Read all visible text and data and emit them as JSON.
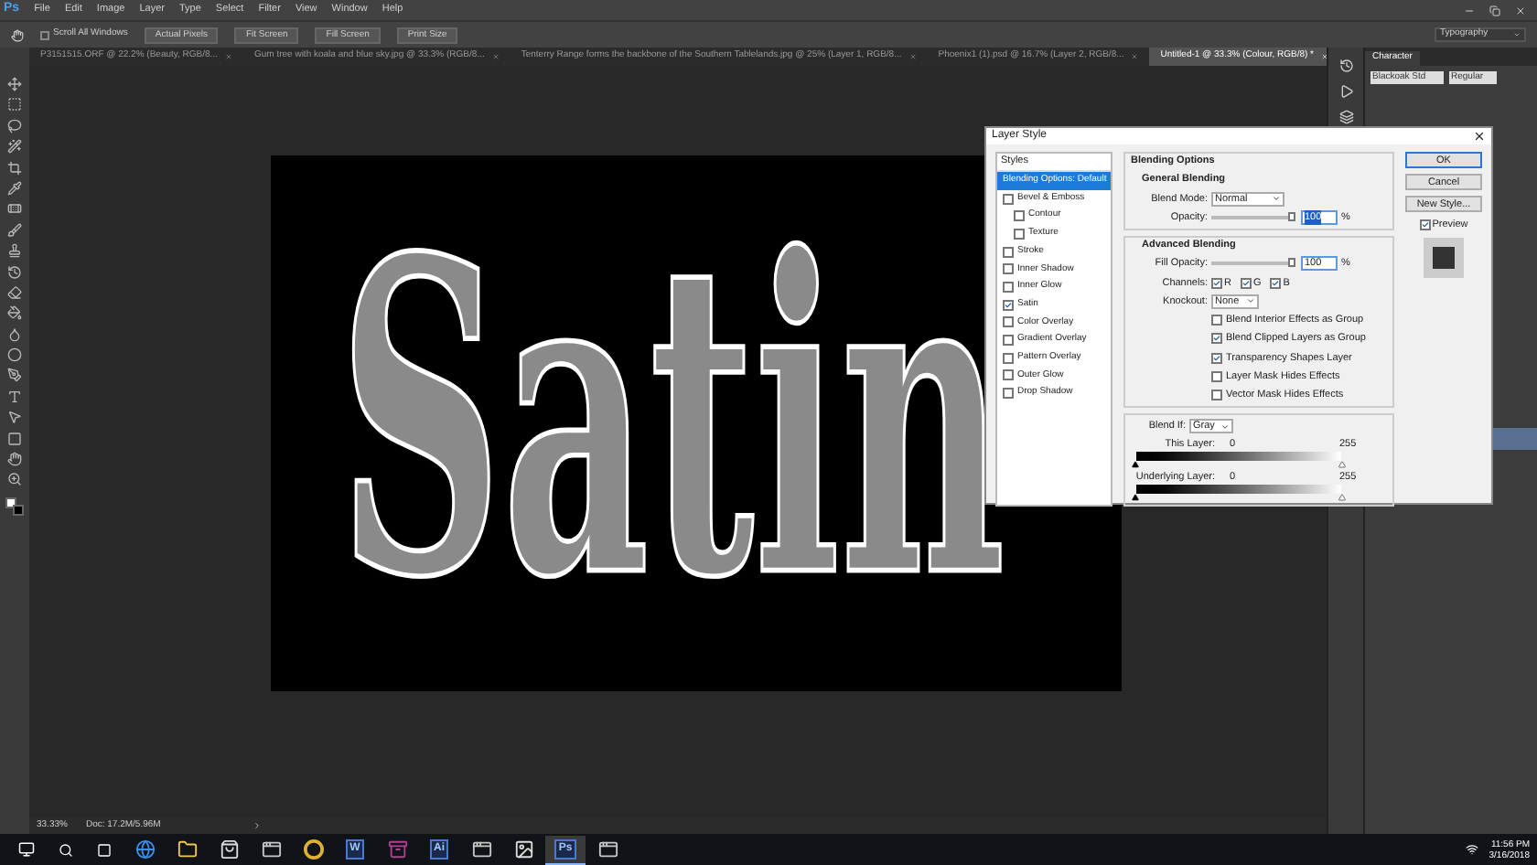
{
  "app": {
    "logo": "Ps"
  },
  "menu": [
    "File",
    "Edit",
    "Image",
    "Layer",
    "Type",
    "Select",
    "Filter",
    "View",
    "Window",
    "Help"
  ],
  "options_bar": {
    "scroll_all_windows": {
      "label": "Scroll All Windows",
      "checked": false
    },
    "buttons": [
      "Actual Pixels",
      "Fit Screen",
      "Fill Screen",
      "Print Size"
    ],
    "workspace": "Typography"
  },
  "tabs": [
    {
      "label": "P3151515.ORF @ 22.2% (Beauty, RGB/8...",
      "selected": false
    },
    {
      "label": "Gum tree with koala and blue sky.jpg @ 33.3% (RGB/8...",
      "selected": false
    },
    {
      "label": "Tenterry Range forms the backbone of the Southern Tablelands.jpg @ 25% (Layer 1, RGB/8...",
      "selected": false
    },
    {
      "label": "Phoenix1 (1).psd @ 16.7% (Layer 2, RGB/8...",
      "selected": false
    },
    {
      "label": "Untitled-1 @ 33.3% (Colour, RGB/8) *",
      "selected": true
    }
  ],
  "canvas": {
    "text": "Satin"
  },
  "character_panel": {
    "title": "Character",
    "font_family": "Blackoak Std",
    "font_style": "Regular"
  },
  "dialog": {
    "title": "Layer Style",
    "styles_header": "Styles",
    "styles": [
      {
        "label": "Blending Options: Default",
        "kind": "plain",
        "selected": true
      },
      {
        "label": "Bevel & Emboss",
        "kind": "check",
        "checked": false,
        "selected": false,
        "children": [
          {
            "label": "Contour",
            "kind": "check",
            "checked": false,
            "selected": false
          },
          {
            "label": "Texture",
            "kind": "check",
            "checked": false,
            "selected": false
          }
        ]
      },
      {
        "label": "Stroke",
        "kind": "check",
        "checked": false,
        "selected": false
      },
      {
        "label": "Inner Shadow",
        "kind": "check",
        "checked": false,
        "selected": false
      },
      {
        "label": "Inner Glow",
        "kind": "check",
        "checked": false,
        "selected": false
      },
      {
        "label": "Satin",
        "kind": "check",
        "checked": true,
        "selected": false
      },
      {
        "label": "Color Overlay",
        "kind": "check",
        "checked": false,
        "selected": false
      },
      {
        "label": "Gradient Overlay",
        "kind": "check",
        "checked": false,
        "selected": false
      },
      {
        "label": "Pattern Overlay",
        "kind": "check",
        "checked": false,
        "selected": false
      },
      {
        "label": "Outer Glow",
        "kind": "check",
        "checked": false,
        "selected": false
      },
      {
        "label": "Drop Shadow",
        "kind": "check",
        "checked": false,
        "selected": false
      }
    ],
    "blending": {
      "title": "Blending Options",
      "general": {
        "title": "General Blending",
        "blend_mode_label": "Blend Mode:",
        "blend_mode": "Normal",
        "opacity": {
          "label": "Opacity:",
          "level": 1,
          "value": "100",
          "unit": "%"
        }
      },
      "advanced": {
        "title": "Advanced Blending",
        "fill_opacity": {
          "label": "Fill Opacity:",
          "level": 1,
          "value": "100",
          "unit": "%"
        },
        "channels_label": "Channels:",
        "channels": [
          {
            "label": "R",
            "checked": true
          },
          {
            "label": "G",
            "checked": true
          },
          {
            "label": "B",
            "checked": true
          }
        ],
        "knockout_label": "Knockout:",
        "knockout": "None",
        "options": [
          {
            "label": "Blend Interior Effects as Group",
            "checked": false
          },
          {
            "label": "Blend Clipped Layers as Group",
            "checked": true
          },
          {
            "label": "Transparency Shapes Layer",
            "checked": true
          },
          {
            "label": "Layer Mask Hides Effects",
            "checked": false
          },
          {
            "label": "Vector Mask Hides Effects",
            "checked": false
          }
        ]
      },
      "blend_if": {
        "label": "Blend If:",
        "value": "Gray",
        "layers": [
          {
            "label": "This Layer:",
            "min": "0",
            "max": "255"
          },
          {
            "label": "Underlying Layer:",
            "min": "0",
            "max": "255"
          }
        ]
      }
    },
    "buttons": [
      {
        "label": "OK",
        "default": true
      },
      {
        "label": "Cancel",
        "default": false
      },
      {
        "label": "New Style...",
        "default": false
      }
    ],
    "preview": {
      "label": "Preview",
      "checked": true
    }
  },
  "status_bar": {
    "zoom": "33.33%",
    "doc": "Doc: 17.2M/5.96M"
  },
  "taskbar": {
    "apps": [
      {
        "kind": "edge",
        "active": false
      },
      {
        "kind": "folder",
        "active": false
      },
      {
        "kind": "store",
        "active": false
      },
      {
        "kind": "app",
        "active": false
      },
      {
        "kind": "chrome",
        "active": false
      },
      {
        "kind": "letter",
        "label": "W",
        "active": false
      },
      {
        "kind": "archive",
        "active": false
      },
      {
        "kind": "letter",
        "label": "Ai",
        "active": false
      },
      {
        "kind": "app",
        "active": false
      },
      {
        "kind": "photos",
        "active": false
      },
      {
        "kind": "letter",
        "label": "Ps",
        "active": true
      },
      {
        "kind": "app",
        "active": false
      }
    ],
    "time": "11:56 PM",
    "date": "3/16/2018"
  }
}
